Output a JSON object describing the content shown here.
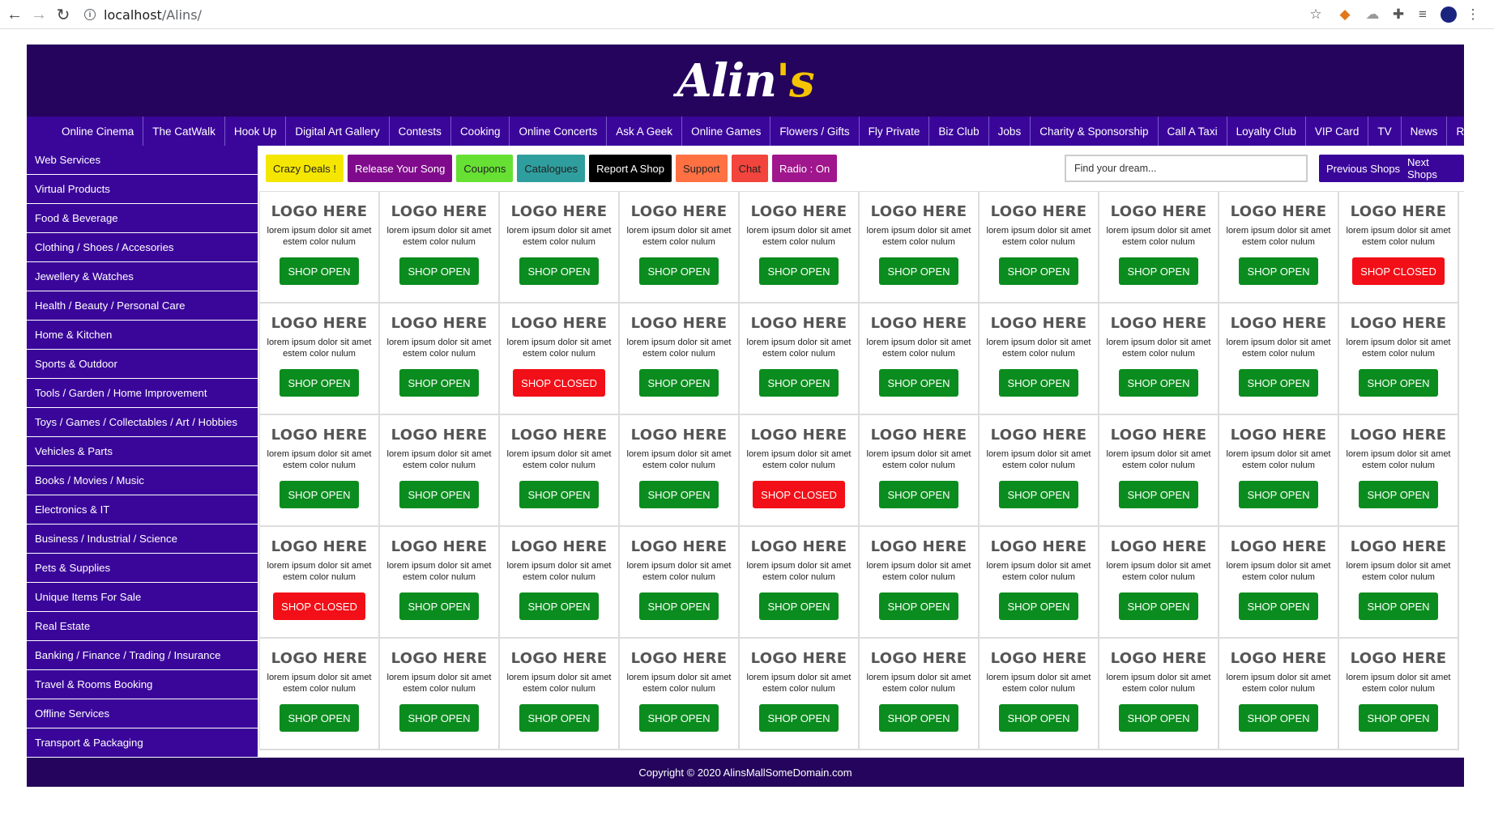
{
  "browser": {
    "url_host": "localhost",
    "url_path": "/Alins/"
  },
  "site": {
    "logo": "Alin",
    "logo_apos": "'s",
    "top_nav": [
      "Online Cinema",
      "The CatWalk",
      "Hook Up",
      "Digital Art Gallery",
      "Contests",
      "Cooking",
      "Online Concerts",
      "Ask A Geek",
      "Online Games",
      "Flowers / Gifts",
      "Fly Private",
      "Biz Club",
      "Jobs",
      "Charity & Sponsorship",
      "Call A Taxi",
      "Loyalty Club",
      "VIP Card",
      "TV",
      "News",
      "Rent Shop Space"
    ],
    "sidebar": [
      "Web Services",
      "Virtual Products",
      "Food & Beverage",
      "Clothing / Shoes / Accesories",
      "Jewellery & Watches",
      "Health / Beauty / Personal Care",
      "Home & Kitchen",
      "Sports & Outdoor",
      "Tools / Garden / Home Improvement",
      "Toys / Games / Collectables / Art / Hobbies",
      "Vehicles & Parts",
      "Books / Movies / Music",
      "Electronics & IT",
      "Business / Industrial / Science",
      "Pets & Supplies",
      "Unique Items For Sale",
      "Real Estate",
      "Banking / Finance / Trading / Insurance",
      "Travel & Rooms Booking",
      "Offline Services",
      "Transport & Packaging"
    ],
    "toolbar": [
      {
        "label": "Crazy Deals !",
        "bg": "#f5e600",
        "fg": "#222"
      },
      {
        "label": "Release Your Song",
        "bg": "#800a8c",
        "fg": "#fff"
      },
      {
        "label": "Coupons",
        "bg": "#66e033",
        "fg": "#222"
      },
      {
        "label": "Catalogues",
        "bg": "#2f9e9e",
        "fg": "#222"
      },
      {
        "label": "Report A Shop",
        "bg": "#000000",
        "fg": "#fff"
      },
      {
        "label": "Support",
        "bg": "#ff7043",
        "fg": "#222"
      },
      {
        "label": "Chat",
        "bg": "#f2453d",
        "fg": "#222"
      },
      {
        "label": "Radio : On",
        "bg": "#a0168c",
        "fg": "#fff"
      }
    ],
    "search_placeholder": "Find your dream...",
    "prev_shops": "Previous Shops",
    "next_shops": "Next Shops",
    "shop_logo": "LOGO HERE",
    "shop_desc": "lorem ipsum dolor sit amet estem color nulum",
    "open_label": "SHOP OPEN",
    "closed_label": "SHOP CLOSED",
    "shops_status": [
      [
        "open",
        "open",
        "open",
        "open",
        "open",
        "open",
        "open",
        "open",
        "open",
        "closed"
      ],
      [
        "open",
        "open",
        "closed",
        "open",
        "open",
        "open",
        "open",
        "open",
        "open",
        "open"
      ],
      [
        "open",
        "open",
        "open",
        "open",
        "closed",
        "open",
        "open",
        "open",
        "open",
        "open"
      ],
      [
        "closed",
        "open",
        "open",
        "open",
        "open",
        "open",
        "open",
        "open",
        "open",
        "open"
      ],
      [
        "open",
        "open",
        "open",
        "open",
        "open",
        "open",
        "open",
        "open",
        "open",
        "open"
      ]
    ],
    "footer": "Copyright © 2020 AlinsMallSomeDomain.com"
  },
  "colors": {
    "header_bg": "#24045c",
    "nav_bg": "#3a069a",
    "open": "#0a8c1e",
    "closed": "#f20f17"
  }
}
